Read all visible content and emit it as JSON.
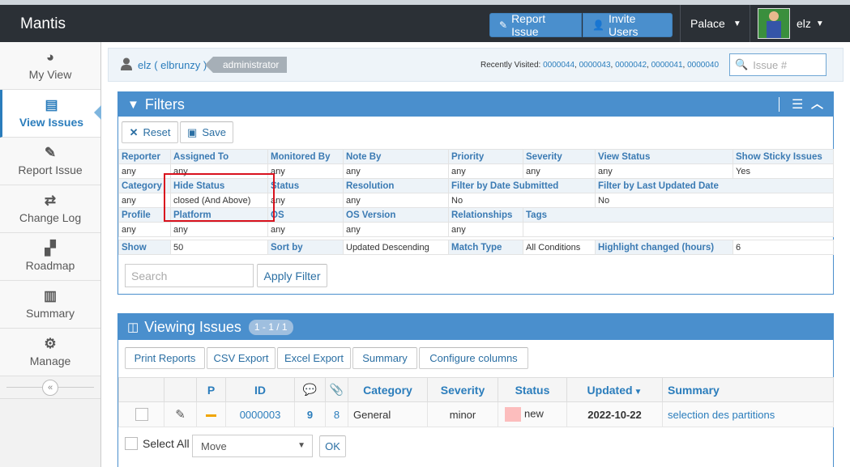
{
  "app": {
    "title": "Mantis"
  },
  "navbar": {
    "report_issue": "Report Issue",
    "invite_users": "Invite Users",
    "project": "Palace",
    "username": "elz"
  },
  "sidebar": {
    "items": [
      {
        "label": "My View",
        "icon": "dashboard-icon"
      },
      {
        "label": "View Issues",
        "icon": "list-icon"
      },
      {
        "label": "Report Issue",
        "icon": "edit-icon"
      },
      {
        "label": "Change Log",
        "icon": "retweet-icon"
      },
      {
        "label": "Roadmap",
        "icon": "road-icon"
      },
      {
        "label": "Summary",
        "icon": "bar-chart-icon"
      },
      {
        "label": "Manage",
        "icon": "gears-icon"
      }
    ]
  },
  "breadcrumb": {
    "user": "elz ( elbrunzy )",
    "role": "administrator",
    "recent_label": "Recently Visited:",
    "recent": [
      "0000044",
      "0000043",
      "0000042",
      "0000041",
      "0000040"
    ],
    "issue_placeholder": "Issue #"
  },
  "filters": {
    "title": "Filters",
    "reset": "Reset",
    "save": "Save",
    "row1_labels": [
      "Reporter",
      "Assigned To",
      "Monitored By",
      "Note By",
      "Priority",
      "Severity",
      "View Status",
      "Show Sticky Issues"
    ],
    "row1_values": [
      "any",
      "any",
      "any",
      "any",
      "any",
      "any",
      "any",
      "Yes"
    ],
    "row2_labels": [
      "Category",
      "Hide Status",
      "Status",
      "Resolution",
      "Filter by Date Submitted",
      "Filter by Last Updated Date"
    ],
    "row2_values": [
      "any",
      "closed (And Above)",
      "any",
      "any",
      "No",
      "No"
    ],
    "row3_labels": [
      "Profile",
      "Platform",
      "OS",
      "OS Version",
      "Relationships",
      "Tags"
    ],
    "row3_values": [
      "any",
      "any",
      "any",
      "any",
      "any",
      ""
    ],
    "row4": [
      "Show",
      "50",
      "Sort by",
      "Updated Descending",
      "Match Type",
      "All Conditions",
      "Highlight changed (hours)",
      "6"
    ],
    "search_placeholder": "Search",
    "apply": "Apply Filter"
  },
  "viewing": {
    "title": "Viewing Issues",
    "count": "1 - 1 / 1",
    "buttons": [
      "Print Reports",
      "CSV Export",
      "Excel Export",
      "Summary",
      "Configure columns"
    ],
    "columns": [
      "",
      "",
      "P",
      "ID",
      "",
      "",
      "Category",
      "Severity",
      "Status",
      "Updated",
      "Summary"
    ],
    "row": {
      "id": "0000003",
      "notes": "9",
      "files": "8",
      "category": "General",
      "severity": "minor",
      "status": "new",
      "updated": "2022-10-22",
      "summary": "selection des partitions"
    },
    "select_all": "Select All",
    "action": "Move",
    "ok": "OK"
  }
}
